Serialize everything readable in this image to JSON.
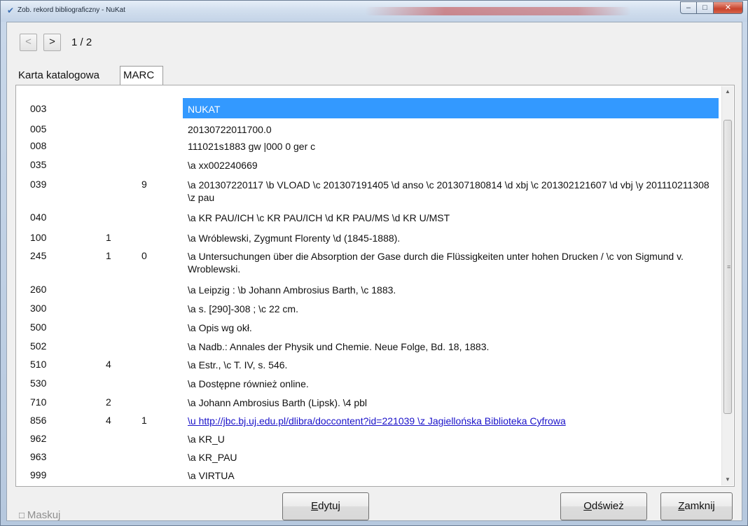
{
  "window": {
    "title": "Zob. rekord bibliograficzny - NuKat"
  },
  "nav": {
    "prev_label": "<",
    "next_label": ">",
    "page_counter": "1 / 2"
  },
  "tabs": [
    {
      "label": "Karta katalogowa"
    },
    {
      "label": "MARC"
    }
  ],
  "marc_rows": [
    {
      "tag": "003",
      "ind1": "",
      "ind2": "",
      "value": "NUKAT"
    },
    {
      "tag": "005",
      "ind1": "",
      "ind2": "",
      "value": "20130722011700.0"
    },
    {
      "tag": "008",
      "ind1": "",
      "ind2": "",
      "value": "111021s1883    gw        |000 0 ger c"
    },
    {
      "tag": "035",
      "ind1": "",
      "ind2": "",
      "value": "\\a xx002240669"
    },
    {
      "tag": "039",
      "ind1": "",
      "ind2": "9",
      "value": "\\a 201307220117 \\b VLOAD \\c 201307191405 \\d anso \\c 201307180814 \\d xbj \\c 201302121607 \\d vbj \\y 201110211308 \\z pau"
    },
    {
      "tag": "040",
      "ind1": "",
      "ind2": "",
      "value": "\\a KR PAU/ICH \\c KR PAU/ICH \\d KR PAU/MS \\d KR U/MST"
    },
    {
      "tag": "100",
      "ind1": "1",
      "ind2": "",
      "value": "\\a Wróblewski, Zygmunt Florenty \\d (1845-1888)."
    },
    {
      "tag": "245",
      "ind1": "1",
      "ind2": "0",
      "value": "\\a Untersuchungen über die Absorption der Gase durch die Flüssigkeiten unter hohen Drucken / \\c von Sigmund v. Wroblewski."
    },
    {
      "tag": "260",
      "ind1": "",
      "ind2": "",
      "value": "\\a Leipzig : \\b Johann Ambrosius Barth, \\c 1883."
    },
    {
      "tag": "300",
      "ind1": "",
      "ind2": "",
      "value": "\\a s. [290]-308 ; \\c 22 cm."
    },
    {
      "tag": "500",
      "ind1": "",
      "ind2": "",
      "value": "\\a Opis wg okł."
    },
    {
      "tag": "502",
      "ind1": "",
      "ind2": "",
      "value": "\\a Nadb.: Annales der Physik und Chemie. Neue Folge, Bd. 18, 1883."
    },
    {
      "tag": "510",
      "ind1": "4",
      "ind2": "",
      "value": "\\a Estr., \\c T. IV, s. 546."
    },
    {
      "tag": "530",
      "ind1": "",
      "ind2": "",
      "value": "\\a Dostępne również online."
    },
    {
      "tag": "710",
      "ind1": "2",
      "ind2": "",
      "value": "\\a Johann Ambrosius Barth (Lipsk). \\4 pbl"
    },
    {
      "tag": "856",
      "ind1": "4",
      "ind2": "1",
      "value": "\\u http://jbc.bj.uj.edu.pl/dlibra/doccontent?id=221039 \\z Jagiellońska Biblioteka Cyfrowa"
    },
    {
      "tag": "962",
      "ind1": "",
      "ind2": "",
      "value": "\\a KR_U"
    },
    {
      "tag": "963",
      "ind1": "",
      "ind2": "",
      "value": "\\a KR_PAU"
    },
    {
      "tag": "999",
      "ind1": "",
      "ind2": "",
      "value": "\\a VIRTUA"
    }
  ],
  "footer": {
    "mask_label": "Maskuj",
    "edit_label": "Edytuj",
    "refresh_label": "Odśwież",
    "close_label": "Zamknij"
  }
}
